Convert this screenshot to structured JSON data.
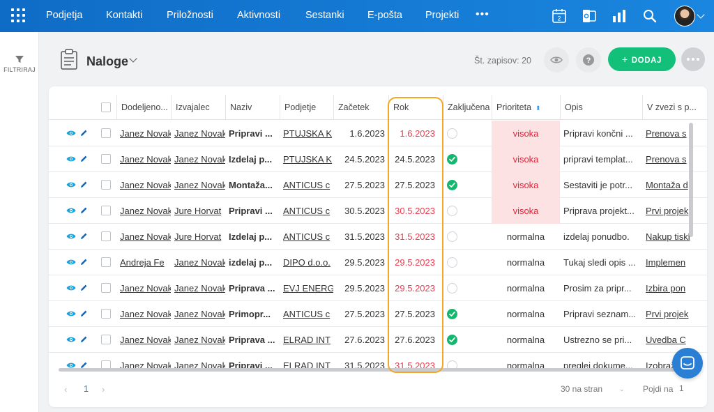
{
  "nav": {
    "items": [
      "Podjetja",
      "Kontakti",
      "Priložnosti",
      "Aktivnosti",
      "Sestanki",
      "E-pošta",
      "Projekti"
    ],
    "more": "•••",
    "calendar_day": "2"
  },
  "sidebar": {
    "filter_label": "FILTRIRAJ"
  },
  "header": {
    "title": "Naloge",
    "record_count": "Št. zapisov: 20",
    "add_button": "DODAJ",
    "add_plus": "+"
  },
  "table": {
    "columns": [
      "Dodeljeno...",
      "Izvajalec",
      "Naziv",
      "Podjetje",
      "Začetek",
      "Rok",
      "Zaključena",
      "Prioriteta",
      "Opis",
      "V zvezi s p..."
    ],
    "sort_icon": "⬍",
    "rows": [
      {
        "assigned": "Janez Novak",
        "executor": "Janez Novak",
        "title": "Pripravi ...",
        "company": "PTUJSKA K",
        "start": "1.6.2023",
        "due": "1.6.2023",
        "due_overdue": true,
        "done": false,
        "priority": "visoka",
        "desc": "Pripravi končni ...",
        "related": "Prenova s"
      },
      {
        "assigned": "Janez Novak",
        "executor": "Janez Novak",
        "title": "Izdelaj p...",
        "company": "PTUJSKA K",
        "start": "24.5.2023",
        "due": "24.5.2023",
        "due_overdue": false,
        "done": true,
        "priority": "visoka",
        "desc": "pripravi templat...",
        "related": "Prenova s"
      },
      {
        "assigned": "Janez Novak",
        "executor": "Janez Novak",
        "title": "Montaža...",
        "company": "ANTICUS c",
        "start": "27.5.2023",
        "due": "27.5.2023",
        "due_overdue": false,
        "done": true,
        "priority": "visoka",
        "desc": "Sestaviti je potr...",
        "related": "Montaža d"
      },
      {
        "assigned": "Janez Novak",
        "executor": "Jure Horvat",
        "title": "Pripravi ...",
        "company": "ANTICUS c",
        "start": "30.5.2023",
        "due": "30.5.2023",
        "due_overdue": true,
        "done": false,
        "priority": "visoka",
        "desc": "Priprava projekt...",
        "related": "Prvi projek"
      },
      {
        "assigned": "Janez Novak",
        "executor": "Jure Horvat",
        "title": "Izdelaj p...",
        "company": "ANTICUS c",
        "start": "31.5.2023",
        "due": "31.5.2023",
        "due_overdue": true,
        "done": false,
        "priority": "normalna",
        "desc": "izdelaj ponudbo.",
        "related": "Nakup tiskl"
      },
      {
        "assigned": "Andreja Fe",
        "executor": "Janez Novak",
        "title": "izdelaj p...",
        "company": "DIPO d.o.o.",
        "start": "29.5.2023",
        "due": "29.5.2023",
        "due_overdue": true,
        "done": false,
        "priority": "normalna",
        "desc": "Tukaj sledi opis ...",
        "related": "Implemen"
      },
      {
        "assigned": "Janez Novak",
        "executor": "Janez Novak",
        "title": "Priprava ...",
        "company": "EVJ ENERG",
        "start": "29.5.2023",
        "due": "29.5.2023",
        "due_overdue": true,
        "done": false,
        "priority": "normalna",
        "desc": "Prosim za pripr...",
        "related": "Izbira pon"
      },
      {
        "assigned": "Janez Novak",
        "executor": "Janez Novak",
        "title": "Primopr...",
        "company": "ANTICUS c",
        "start": "27.5.2023",
        "due": "27.5.2023",
        "due_overdue": false,
        "done": true,
        "priority": "normalna",
        "desc": "Pripravi seznam...",
        "related": "Prvi projek"
      },
      {
        "assigned": "Janez Novak",
        "executor": "Janez Novak",
        "title": "Priprava ...",
        "company": "ELRAD INT",
        "start": "27.6.2023",
        "due": "27.6.2023",
        "due_overdue": false,
        "done": true,
        "priority": "normalna",
        "desc": "Ustrezno se pri...",
        "related": "Uvedba C"
      },
      {
        "assigned": "Janez Novak",
        "executor": "Janez Novak",
        "title": "Pripravi ...",
        "company": "ELRAD INT",
        "start": "31.5.2023",
        "due": "31.5.2023",
        "due_overdue": true,
        "done": false,
        "priority": "normalna",
        "desc": "preglej dokume...",
        "related": "Izobraž"
      }
    ]
  },
  "footer": {
    "prev": "‹",
    "page": "1",
    "next": "›",
    "per_page": "30 na stran",
    "per_page_caret": "⌄",
    "goto_label": "Pojdi na",
    "goto_value": "1"
  },
  "colors": {
    "nav_bg": "#1a86df",
    "accent_green": "#13c07a",
    "overdue_red": "#ef3b4e",
    "priority_high_bg": "#fde2e4",
    "highlight_orange": "#f3a626"
  }
}
